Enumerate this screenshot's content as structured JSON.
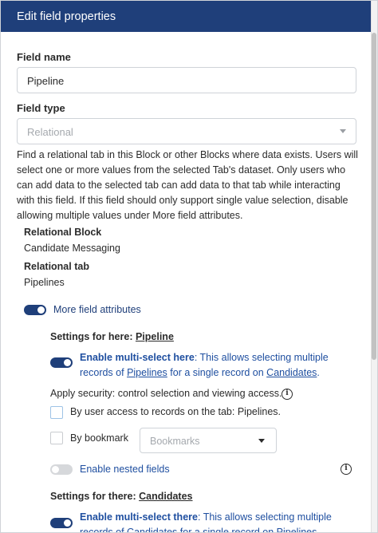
{
  "header": {
    "title": "Edit field properties"
  },
  "field_name": {
    "label": "Field name",
    "value": "Pipeline"
  },
  "field_type": {
    "label": "Field type",
    "value": "Relational"
  },
  "description": "Find a relational tab in this Block or other Blocks where data exists. Users will select one or more values from the selected Tab's dataset. Only users who can add data to the selected tab can add data to that tab while interacting with this field. If this field should only support single value selection, disable allowing multiple values under More field attributes.",
  "relational_block": {
    "label": "Relational Block",
    "value": "Candidate Messaging"
  },
  "relational_tab": {
    "label": "Relational tab",
    "value": "Pipelines"
  },
  "more_attributes": {
    "label": "More field attributes",
    "enabled": true
  },
  "settings_here": {
    "prefix": "Settings for here: ",
    "target": "Pipeline",
    "multi_select": {
      "enabled": true,
      "title": "Enable multi-select here",
      "text_1": ": This allows selecting multiple",
      "text_2": "records of ",
      "link_1": "Pipelines",
      "text_3": " for a single record on ",
      "link_2": "Candidates",
      "text_4": "."
    }
  },
  "security": {
    "label": "Apply security: control selection and viewing access.",
    "by_access": {
      "label": "By user access to records on the tab: Pipelines.",
      "checked": false
    },
    "by_bookmark": {
      "label": "By bookmark",
      "checked": false,
      "placeholder": "Bookmarks"
    }
  },
  "nested_fields": {
    "label": "Enable nested fields",
    "enabled": false
  },
  "settings_there": {
    "prefix": "Settings for there: ",
    "target": "Candidates",
    "multi_select": {
      "enabled": true,
      "title": "Enable multi-select there",
      "text_1": ": This allows selecting multiple",
      "text_2": "records of Candidates for a single record on Pipelines."
    }
  },
  "colors": {
    "header_bg": "#1f3f7a",
    "accent": "#1f4fa0",
    "toggle_on": "#1f3f7a",
    "toggle_off": "#d6d8db"
  },
  "icons": {
    "info": "info-icon",
    "dropdown": "chevron-down-icon"
  }
}
